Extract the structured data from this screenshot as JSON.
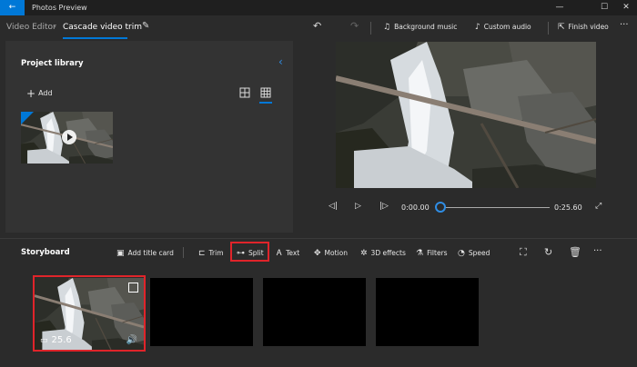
{
  "app": {
    "title": "Photos Preview"
  },
  "window_controls": {
    "minimize": "—",
    "maximize": "☐",
    "close": "✕"
  },
  "breadcrumb": {
    "root": "Video Editor",
    "current": "Cascade video trim"
  },
  "toolbar": {
    "background_music": "Background music",
    "custom_audio": "Custom audio",
    "finish_video": "Finish video",
    "more": "···"
  },
  "library": {
    "title": "Project library",
    "add_label": "Add"
  },
  "player": {
    "current_time": "0:00.00",
    "end_time": "0:25.60",
    "progress": 0.0
  },
  "storyboard": {
    "title": "Storyboard",
    "add_title_card": "Add title card",
    "trim": "Trim",
    "split": "Split",
    "text": "Text",
    "motion": "Motion",
    "effects_3d": "3D effects",
    "filters": "Filters",
    "speed": "Speed",
    "more": "···",
    "cards": [
      {
        "duration": "25.6"
      }
    ]
  },
  "colors": {
    "accent": "#0078d7",
    "highlight": "#e0242a",
    "background": "#2b2b2b"
  }
}
